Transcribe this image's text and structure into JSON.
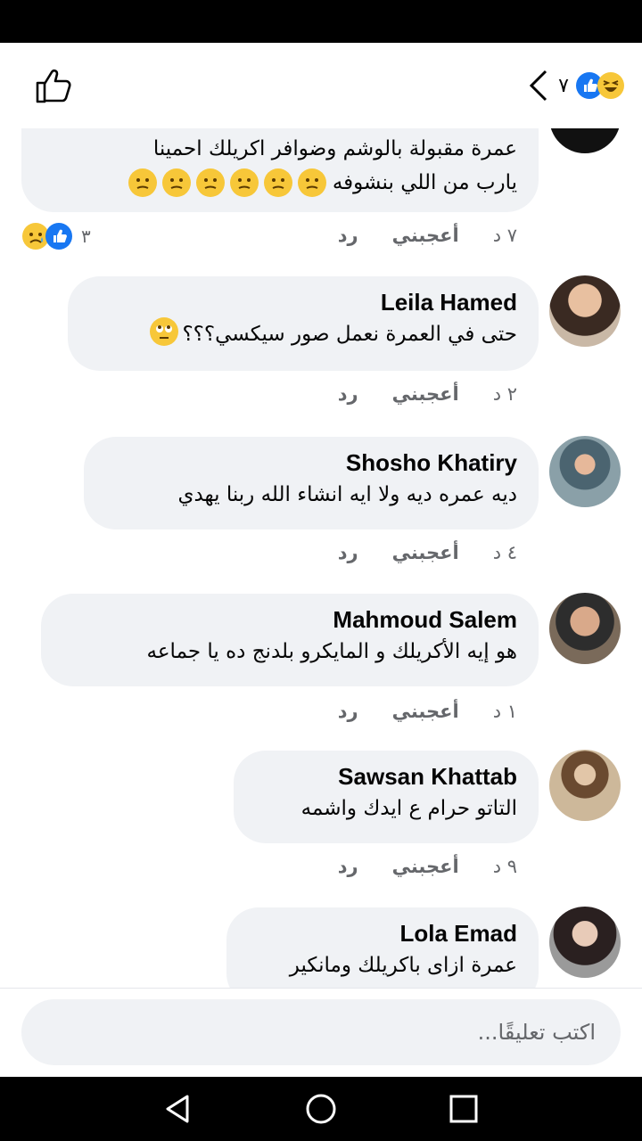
{
  "header": {
    "reaction_count": "٧"
  },
  "comments": [
    {
      "text_line1": "عمرة مقبولة بالوشم وضوافر اكريلك احمينا",
      "text_line2": "يارب من اللي بنشوفه",
      "time": "٧ د",
      "like": "أعجبني",
      "reply": "رد",
      "reaction_count": "٣"
    },
    {
      "author": "Leila Hamed",
      "text": "حتى في العمرة نعمل صور سيكسي؟؟؟",
      "time": "٢ د",
      "like": "أعجبني",
      "reply": "رد"
    },
    {
      "author": "Shosho Khatiry",
      "text": "ديه عمره ديه ولا ايه انشاء الله ربنا يهدي",
      "time": "٤ د",
      "like": "أعجبني",
      "reply": "رد"
    },
    {
      "author": "Mahmoud Salem",
      "text": "هو إيه الأكريلك و المايكرو بلدنج ده يا جماعه",
      "time": "١ د",
      "like": "أعجبني",
      "reply": "رد"
    },
    {
      "author": "Sawsan Khattab",
      "text": "التاتو حرام ع ايدك واشمه",
      "time": "٩ د",
      "like": "أعجبني",
      "reply": "رد"
    },
    {
      "author": "Lola Emad",
      "text": "عمرة ازاى باكريلك ومانكير"
    }
  ],
  "composer": {
    "placeholder": "اكتب تعليقًا..."
  }
}
